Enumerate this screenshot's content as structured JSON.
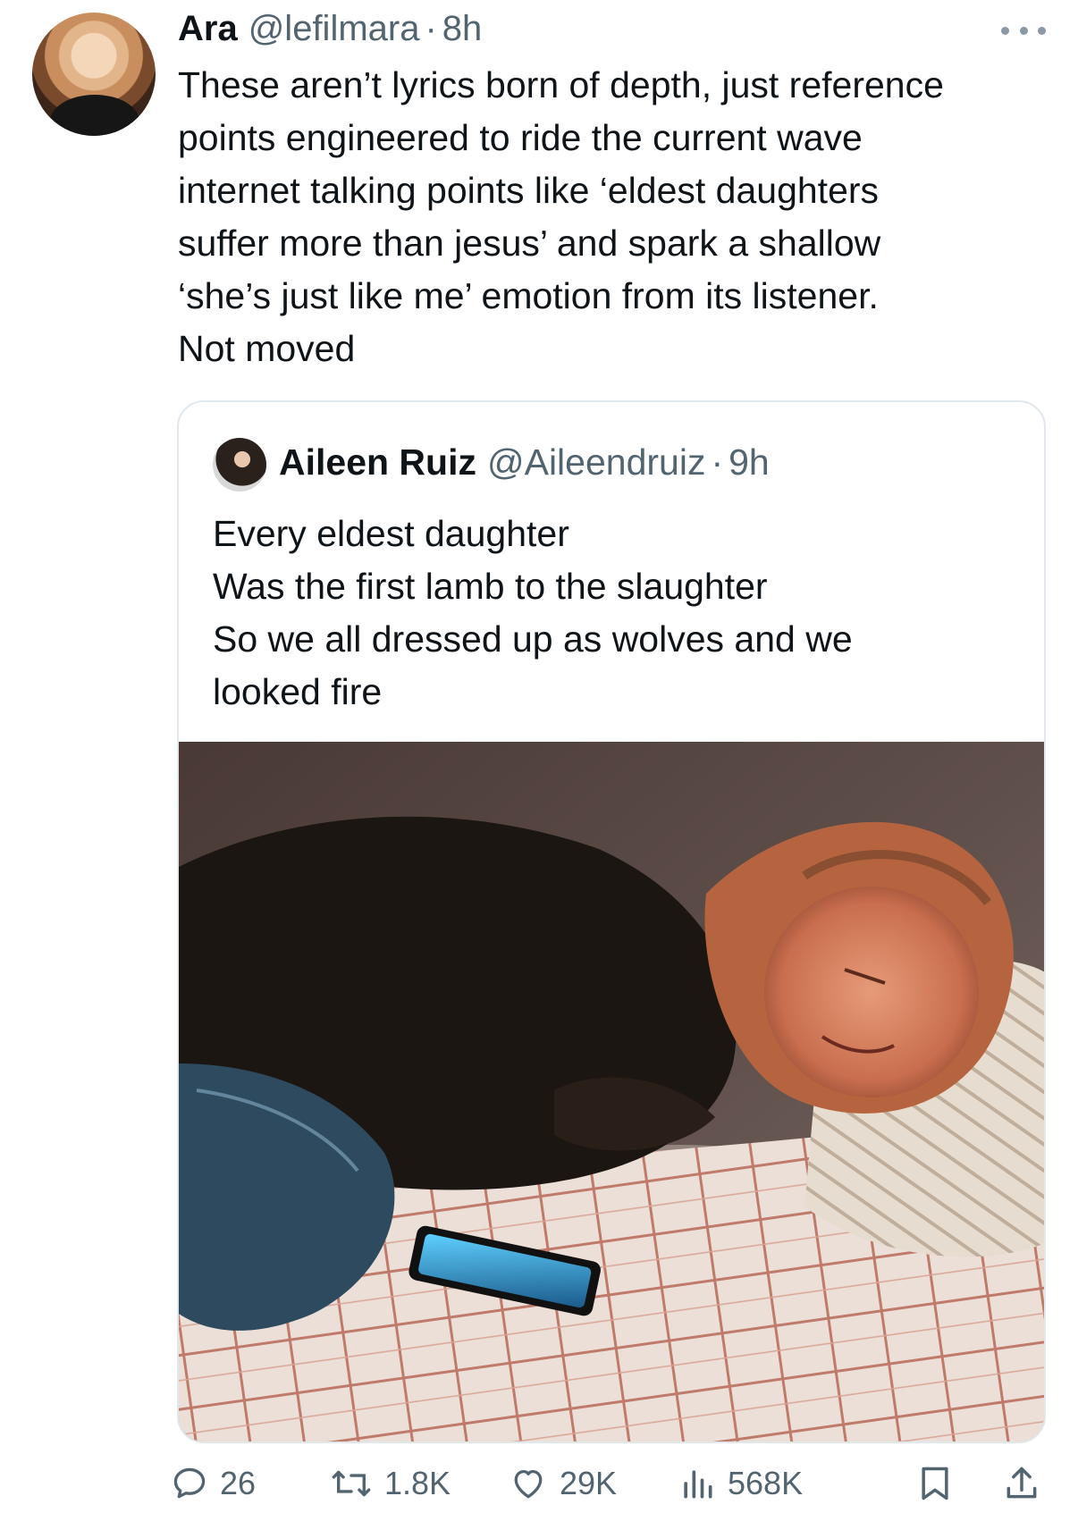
{
  "tweet": {
    "author_name": "Ara",
    "handle": "@lefilmara",
    "separator": "·",
    "time": "8h",
    "text": "These aren’t lyrics born of depth, just reference\npoints engineered to ride the current wave\ninternet talking points like ‘eldest daughters\nsuffer more than jesus’ and spark a shallow\n‘she’s just like me’ emotion from its listener.\nNot moved",
    "more_icon": "more-horizontal-icon"
  },
  "quote": {
    "author_name": "Aileen Ruiz",
    "handle": "@Aileendruiz",
    "separator": "·",
    "time": "9h",
    "text": "Every eldest daughter\nWas the first lamb to the slaughter\nSo we all dressed up as wolves and we\nlooked fire"
  },
  "actions": {
    "replies": "26",
    "reposts": "1.8K",
    "likes": "29K",
    "views": "568K"
  },
  "colors": {
    "text": "#0f1419",
    "muted": "#536471",
    "border": "#e1e8ed"
  }
}
